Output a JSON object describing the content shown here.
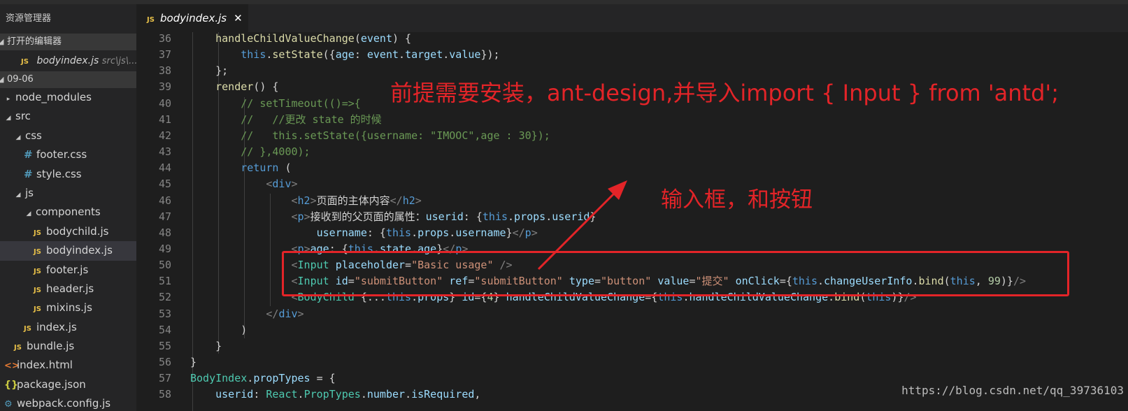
{
  "sidebar": {
    "title": "资源管理器",
    "open_editors_header": "打开的编辑器",
    "open_file": {
      "name": "bodyindex.js",
      "path": "src\\js\\..."
    },
    "folder_header": "09-06",
    "tree": [
      {
        "label": "node_modules",
        "twisty": "▸",
        "icon": ""
      },
      {
        "label": "src",
        "twisty": "◢",
        "icon": ""
      },
      {
        "label": "css",
        "twisty": "◢",
        "icon": ""
      },
      {
        "label": "footer.css",
        "twisty": "",
        "icon": "#"
      },
      {
        "label": "style.css",
        "twisty": "",
        "icon": "#"
      },
      {
        "label": "js",
        "twisty": "◢",
        "icon": ""
      },
      {
        "label": "components",
        "twisty": "◢",
        "icon": ""
      },
      {
        "label": "bodychild.js",
        "twisty": "",
        "icon": "JS"
      },
      {
        "label": "bodyindex.js",
        "twisty": "",
        "icon": "JS"
      },
      {
        "label": "footer.js",
        "twisty": "",
        "icon": "JS"
      },
      {
        "label": "header.js",
        "twisty": "",
        "icon": "JS"
      },
      {
        "label": "mixins.js",
        "twisty": "",
        "icon": "JS"
      },
      {
        "label": "index.js",
        "twisty": "",
        "icon": "JS"
      },
      {
        "label": "bundle.js",
        "twisty": "",
        "icon": "JS"
      },
      {
        "label": "index.html",
        "twisty": "",
        "icon": "<>"
      },
      {
        "label": "package.json",
        "twisty": "",
        "icon": "{}"
      },
      {
        "label": "webpack.config.js",
        "twisty": "",
        "icon": "⚙"
      }
    ]
  },
  "editor": {
    "tab": {
      "icon": "JS",
      "name": "bodyindex.js",
      "close": "✕"
    },
    "lines": [
      {
        "n": "36",
        "code": "    handleChildValueChange(event) {"
      },
      {
        "n": "37",
        "code": "        this.setState({age: event.target.value});"
      },
      {
        "n": "38",
        "code": "    };"
      },
      {
        "n": "39",
        "code": "    render() {"
      },
      {
        "n": "40",
        "code": "        // setTimeout(()=>{"
      },
      {
        "n": "41",
        "code": "        //   //更改 state 的时候"
      },
      {
        "n": "42",
        "code": "        //   this.setState({username: \"IMOOC\",age : 30});"
      },
      {
        "n": "43",
        "code": "        // },4000);"
      },
      {
        "n": "44",
        "code": "        return ("
      },
      {
        "n": "45",
        "code": "            <div>"
      },
      {
        "n": "46",
        "code": "                <h2>页面的主体内容</h2>"
      },
      {
        "n": "47",
        "code": "                <p>接收到的父页面的属性：userid: {this.props.userid}"
      },
      {
        "n": "48",
        "code": "                    username: {this.props.username}</p>"
      },
      {
        "n": "49",
        "code": "                <p>age: {this.state.age}</p>"
      },
      {
        "n": "50",
        "code": "                <Input placeholder=\"Basic usage\" />"
      },
      {
        "n": "51",
        "code": "                <Input id=\"submitButton\" ref=\"submitButton\" type=\"button\" value=\"提交\" onClick={this.changeUserInfo.bind(this, 99)}/>"
      },
      {
        "n": "52",
        "code": "                <BodyChild {...this.props} id={4} handleChildValueChange={this.handleChildValueChange.bind(this)}/>"
      },
      {
        "n": "53",
        "code": "            </div>"
      },
      {
        "n": "54",
        "code": "        )"
      },
      {
        "n": "55",
        "code": "    }"
      },
      {
        "n": "56",
        "code": "}"
      },
      {
        "n": "57",
        "code": "BodyIndex.propTypes = {"
      },
      {
        "n": "58",
        "code": "    userid: React.PropTypes.number.isRequired,"
      }
    ]
  },
  "annotations": {
    "note1": "前提需要安装，ant-design,并导入import { Input } from 'antd';",
    "note2": "输入框，和按钮",
    "color": "#e32428"
  },
  "watermark": "https://blog.csdn.net/qq_39736103",
  "colors": {
    "keyword": "#569cd6",
    "function": "#dcdcaa",
    "property": "#9cdcfe",
    "string": "#ce9178",
    "number": "#b5cea8",
    "comment": "#6a9955",
    "component": "#4ec9b0",
    "js_icon": "#e8c048",
    "css_icon": "#519aba"
  }
}
